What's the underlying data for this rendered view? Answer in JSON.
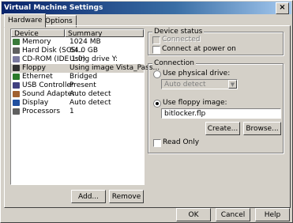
{
  "window": {
    "title": "Virtual Machine Settings",
    "close_glyph": "×"
  },
  "tabs": [
    {
      "label": "Hardware"
    },
    {
      "label": "Options"
    }
  ],
  "device_list": {
    "columns": [
      "Device",
      "Summary"
    ],
    "rows": [
      {
        "device": "Memory",
        "summary": "1024 MB",
        "icon": "memory-icon",
        "color": "#3a7a3a"
      },
      {
        "device": "Hard Disk (SCSI...",
        "summary": "64.0 GB",
        "icon": "hard-disk-icon",
        "color": "#606060"
      },
      {
        "device": "CD-ROM (IDE 1:0)",
        "summary": "Using drive Y:",
        "icon": "cdrom-icon",
        "color": "#7a7aa0"
      },
      {
        "device": "Floppy",
        "summary": "Using image Vista_Pass...",
        "icon": "floppy-icon",
        "color": "#303030",
        "selected": true
      },
      {
        "device": "Ethernet",
        "summary": "Bridged",
        "icon": "ethernet-icon",
        "color": "#2a7a2a"
      },
      {
        "device": "USB Controller",
        "summary": "Present",
        "icon": "usb-icon",
        "color": "#404080"
      },
      {
        "device": "Sound Adapter",
        "summary": "Auto detect",
        "icon": "sound-icon",
        "color": "#a06030"
      },
      {
        "device": "Display",
        "summary": "Auto detect",
        "icon": "display-icon",
        "color": "#2050a0"
      },
      {
        "device": "Processors",
        "summary": "1",
        "icon": "processor-icon",
        "color": "#606060"
      }
    ]
  },
  "list_buttons": {
    "add": "Add...",
    "remove": "Remove"
  },
  "device_status": {
    "label": "Device status",
    "connected": "Connected",
    "connect_power_on": "Connect at power on"
  },
  "connection": {
    "label": "Connection",
    "use_physical": "Use physical drive:",
    "physical_value": "Auto detect",
    "use_image": "Use floppy image:",
    "image_value": "bitlocker.flp",
    "create": "Create...",
    "browse": "Browse...",
    "read_only": "Read Only"
  },
  "footer": {
    "ok": "OK",
    "cancel": "Cancel",
    "help": "Help"
  }
}
